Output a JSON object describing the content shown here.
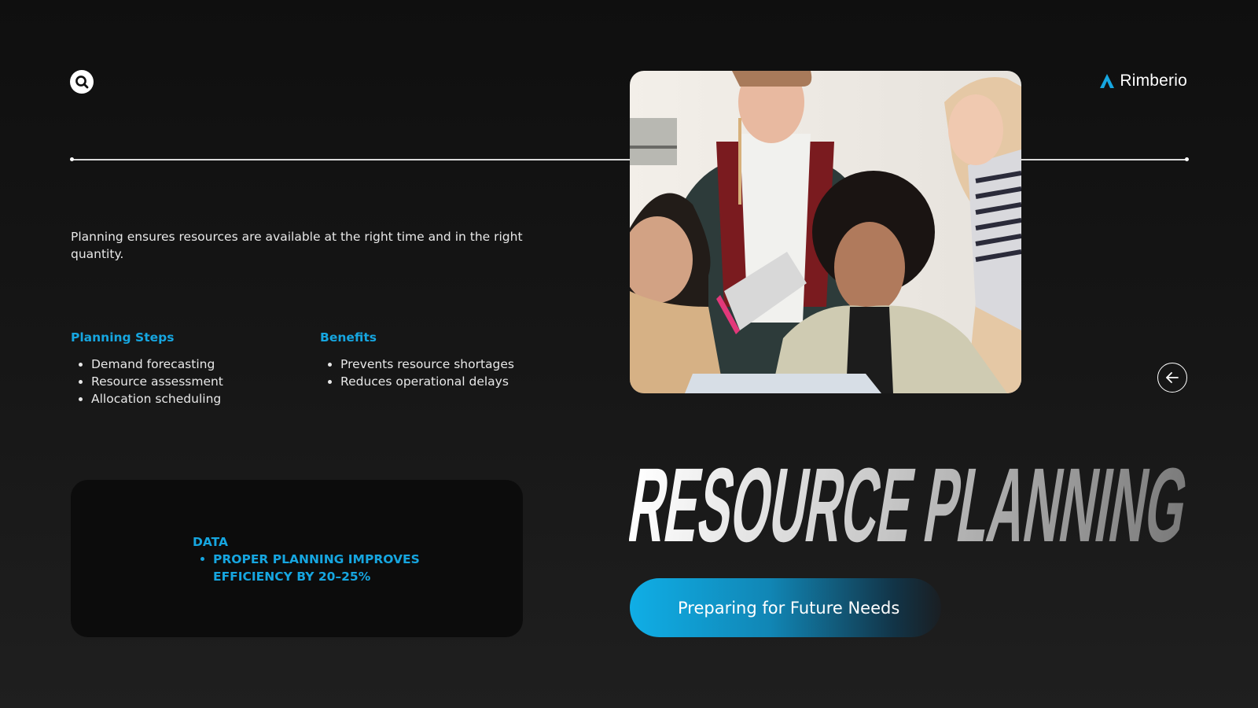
{
  "brand": {
    "name": "Rimberio"
  },
  "intro": {
    "text": "Planning ensures resources are available at the right time and in the right quantity."
  },
  "planning_steps": {
    "title": "Planning Steps",
    "items": [
      "Demand forecasting",
      "Resource assessment",
      "Allocation scheduling"
    ]
  },
  "benefits": {
    "title": "Benefits",
    "items": [
      "Prevents resource shortages",
      "Reduces operational delays"
    ]
  },
  "data_card": {
    "title": "DATA",
    "items": [
      "PROPER PLANNING IMPROVES EFFICIENCY BY 20–25%"
    ]
  },
  "headline": {
    "text": "RESOURCE PLANNING"
  },
  "cta": {
    "label": "Preparing for Future Needs"
  },
  "icons": {
    "search": "search-icon",
    "prev": "arrow-left-icon",
    "brand_logo": "triangle-logo-icon"
  },
  "colors": {
    "accent": "#16a6e0",
    "background": "#141414",
    "card": "#0c0c0c"
  }
}
